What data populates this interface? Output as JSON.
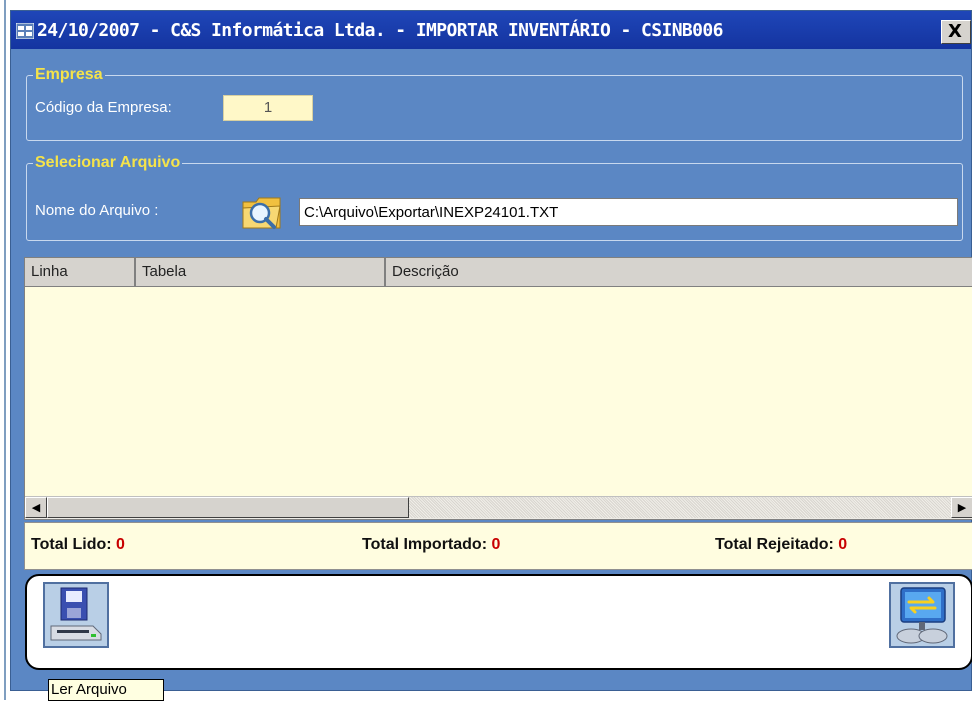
{
  "window": {
    "title": "24/10/2007 - C&S Informática Ltda. - IMPORTAR INVENTÁRIO - CSINB006",
    "close_label": "X"
  },
  "empresa": {
    "legend": "Empresa",
    "codigo_label": "Código da Empresa:",
    "codigo_value": "1"
  },
  "arquivo": {
    "legend": "Selecionar Arquivo",
    "nome_label": "Nome do Arquivo :",
    "path_value": "C:\\Arquivo\\Exportar\\INEXP24101.TXT"
  },
  "grid": {
    "columns": [
      "Linha",
      "Tabela",
      "Descrição"
    ],
    "rows": []
  },
  "totals": {
    "lido_label": "Total Lido:",
    "lido_value": "0",
    "importado_label": "Total Importado:",
    "importado_value": "0",
    "rejeitado_label": "Total Rejeitado:",
    "rejeitado_value": "0"
  },
  "toolbar": {
    "ler_icon": "floppy-disk-drive-icon",
    "importar_icon": "monitor-transfer-icon"
  },
  "tooltip": {
    "text": "Ler Arquivo"
  },
  "colors": {
    "window_bg": "#5b87c4",
    "titlebar": "#1f46b8",
    "legend": "#f5e34a",
    "grid_bg": "#fffde0",
    "total_value": "#c80000"
  }
}
